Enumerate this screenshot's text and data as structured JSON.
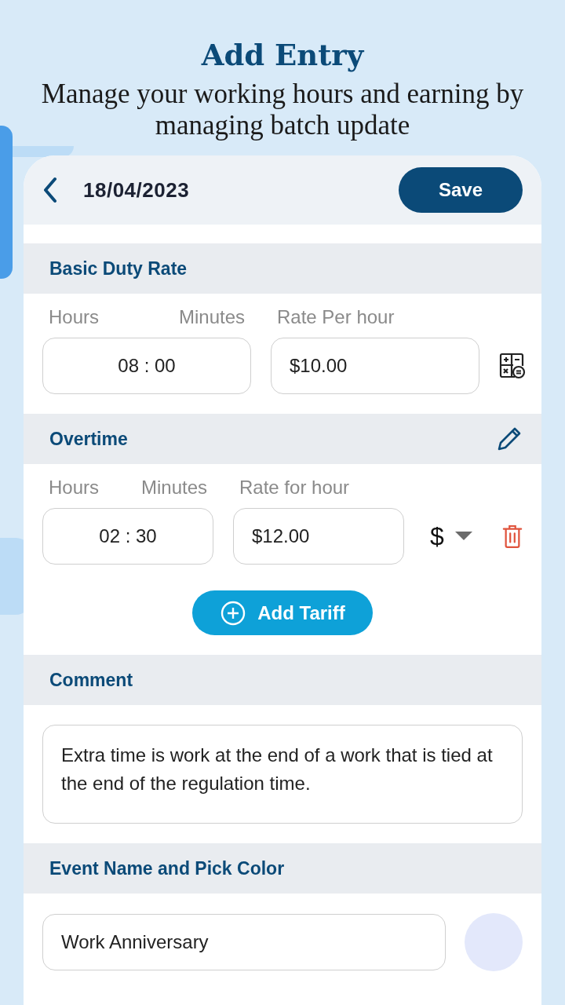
{
  "header": {
    "title": "Add Entry",
    "subtitle": "Manage your working hours and earning by managing batch update"
  },
  "toolbar": {
    "date": "18/04/2023",
    "save_label": "Save"
  },
  "basic_duty": {
    "title": "Basic Duty Rate",
    "labels": [
      "Hours",
      "Minutes",
      "Rate Per hour"
    ],
    "time": "08 : 00",
    "rate": "$10.00"
  },
  "overtime": {
    "title": "Overtime",
    "labels": [
      "Hours",
      "Minutes",
      "Rate for hour"
    ],
    "time": "02 : 30",
    "rate": "$12.00",
    "currency": "$"
  },
  "add_tariff": "Add Tariff",
  "comment": {
    "title": "Comment",
    "text": "Extra time is work at the end of a work that is tied at the end of the regulation time."
  },
  "event": {
    "title": "Event Name and Pick Color",
    "value": "Work Anniversary",
    "color": "#e3e8fb"
  }
}
